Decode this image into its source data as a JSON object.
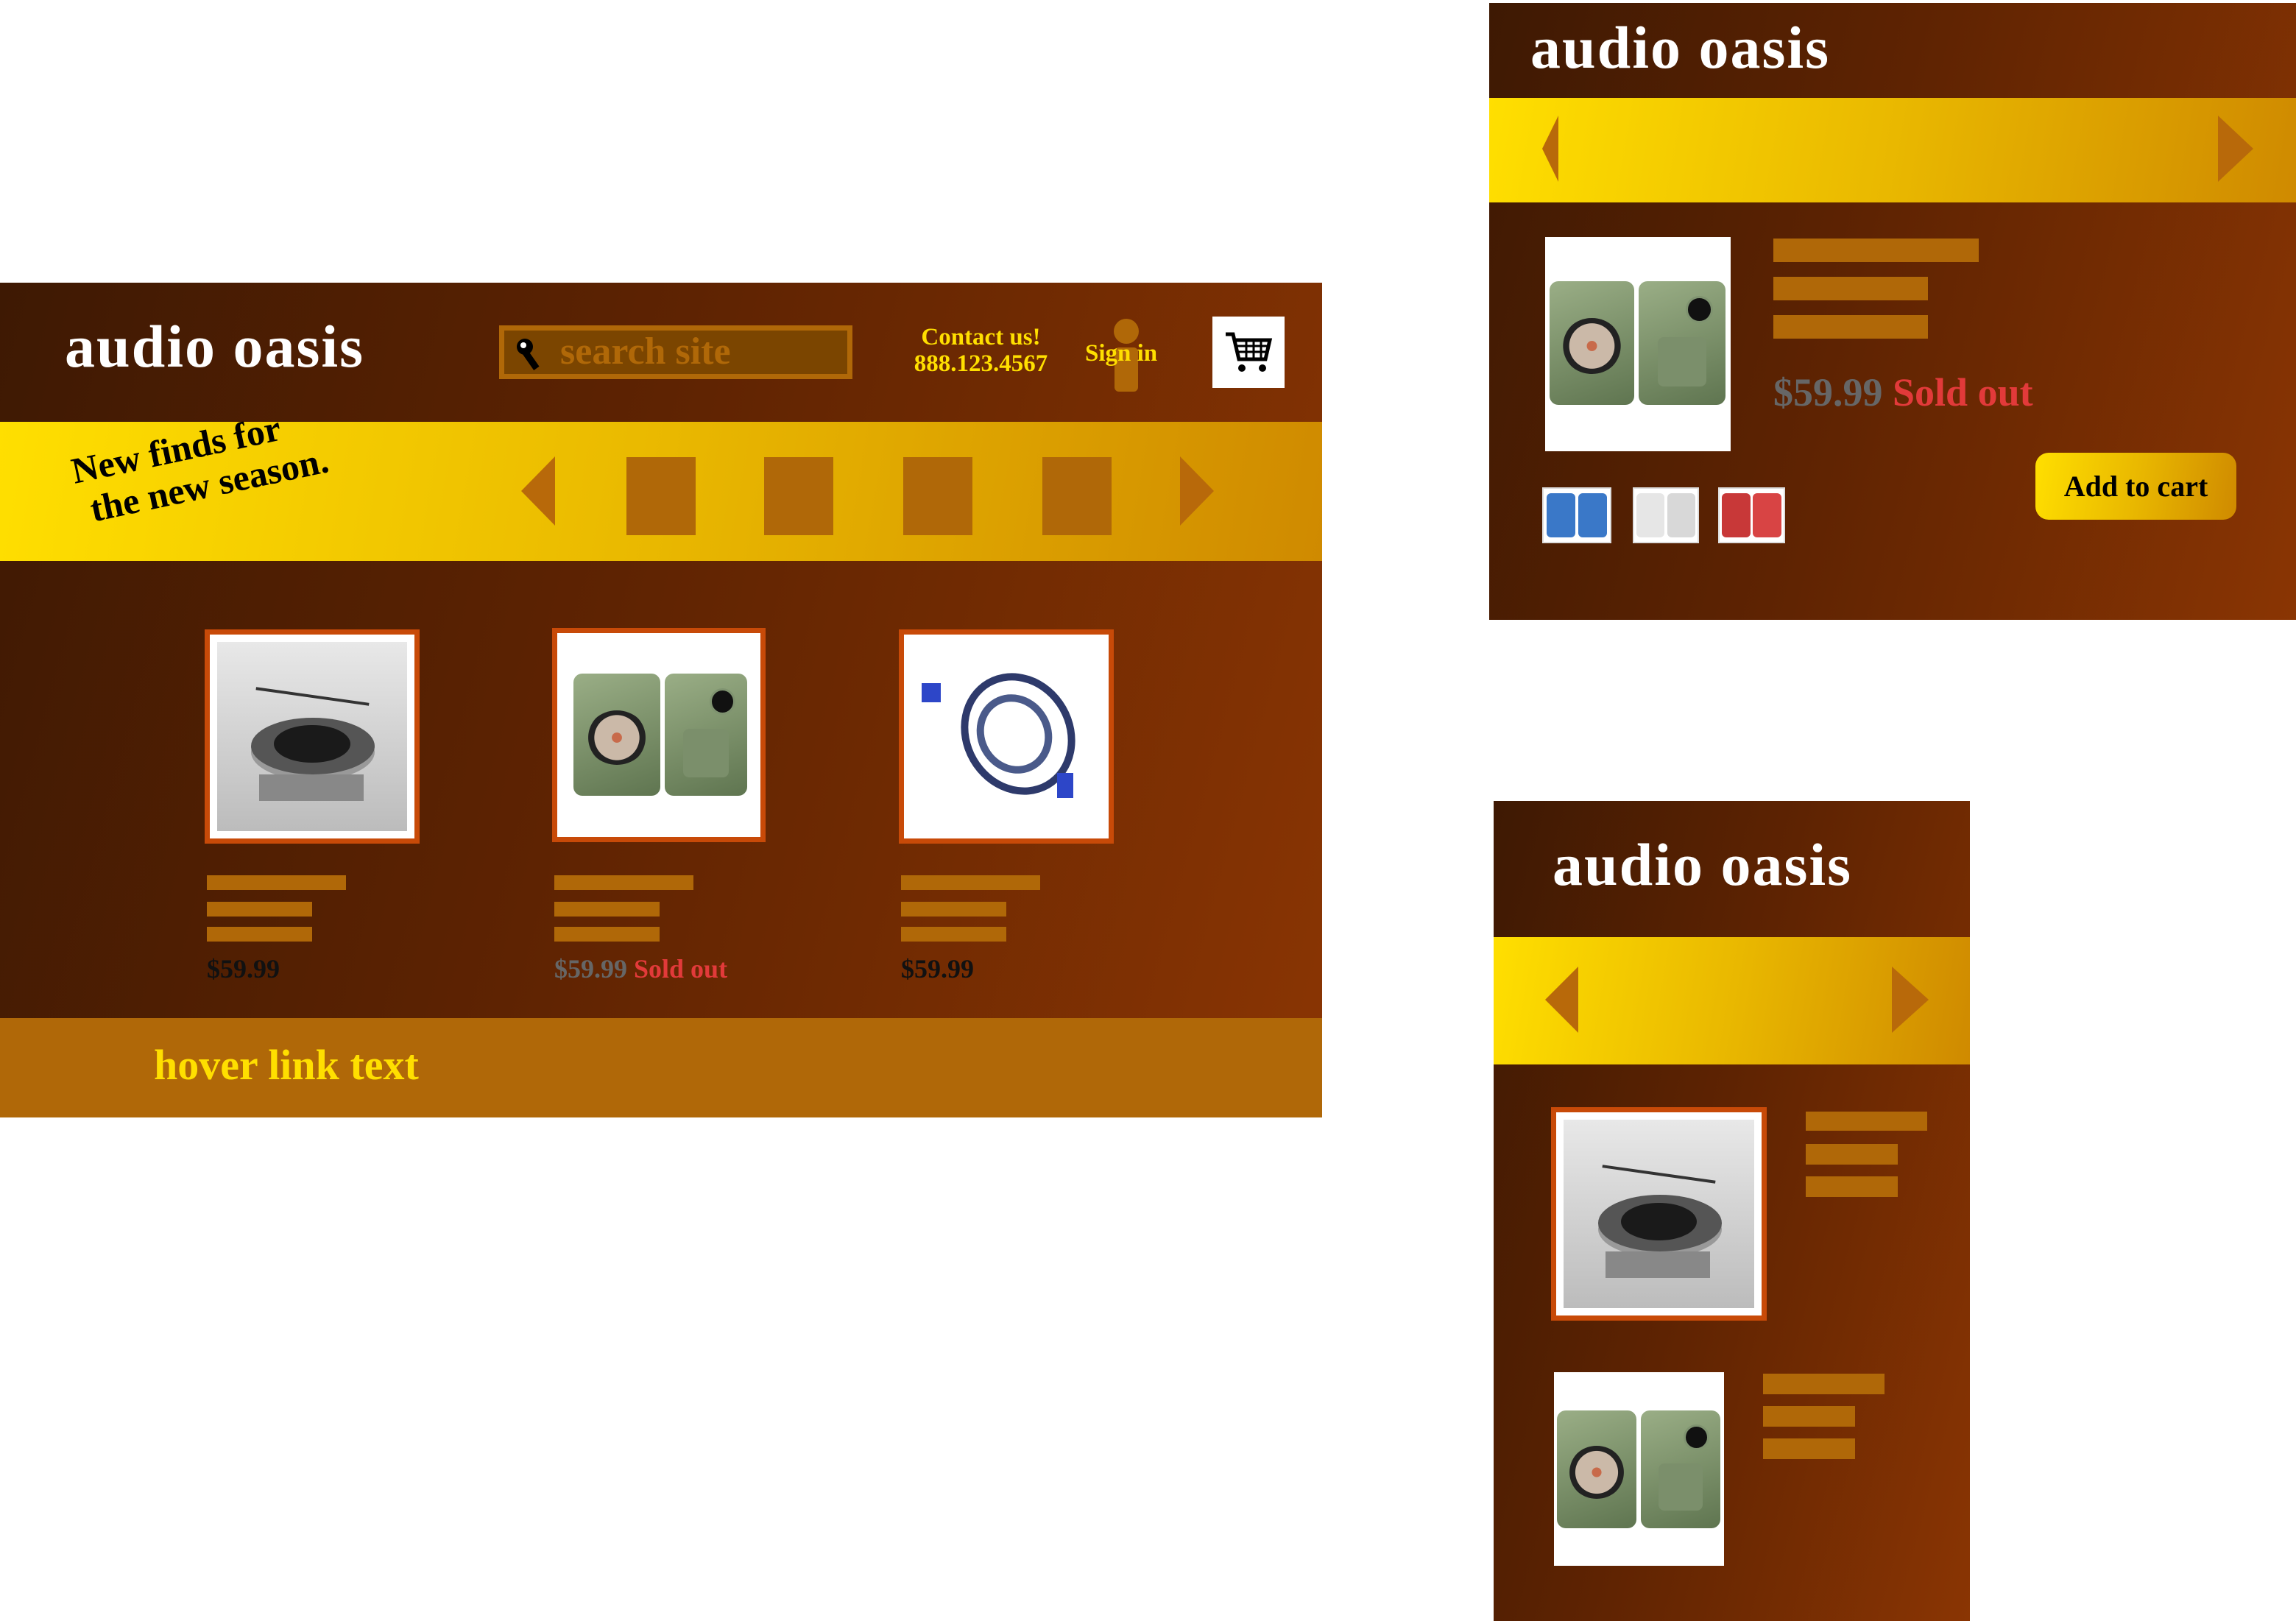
{
  "brand": "audio oasis",
  "desktop": {
    "search": {
      "placeholder": "search site"
    },
    "contact": {
      "label": "Contact us!",
      "phone": "888.123.4567"
    },
    "signin": "Sign in",
    "banner": {
      "line1": "New finds for",
      "line2": "the new season."
    },
    "products": [
      {
        "image": "turntable",
        "price": "$59.99",
        "status": ""
      },
      {
        "image": "green-speakers",
        "price": "$59.99",
        "status": "Sold out"
      },
      {
        "image": "power-cable",
        "price": "$59.99",
        "status": ""
      }
    ],
    "footer_link": "hover link text"
  },
  "tablet": {
    "product": {
      "price": "$59.99",
      "status": "Sold out"
    },
    "thumbnails": [
      "blue",
      "white",
      "red"
    ],
    "add_to_cart": "Add to cart"
  },
  "colors": {
    "accent": "#ffdf00",
    "bar": "#b06808",
    "sold_out": "#e23a3a",
    "bg_dark": "#3e1903",
    "bg_light": "#8a3503"
  }
}
